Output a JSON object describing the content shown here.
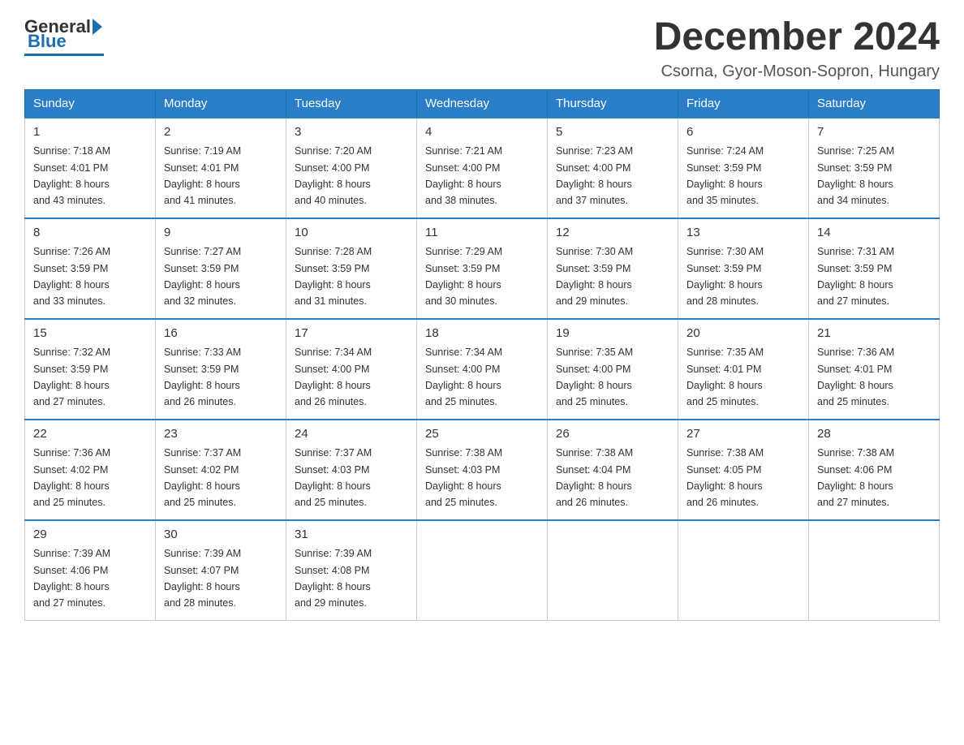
{
  "logo": {
    "general": "General",
    "blue": "Blue"
  },
  "title": "December 2024",
  "subtitle": "Csorna, Gyor-Moson-Sopron, Hungary",
  "days_of_week": [
    "Sunday",
    "Monday",
    "Tuesday",
    "Wednesday",
    "Thursday",
    "Friday",
    "Saturday"
  ],
  "weeks": [
    [
      {
        "day": "1",
        "sunrise": "7:18 AM",
        "sunset": "4:01 PM",
        "daylight": "8 hours and 43 minutes."
      },
      {
        "day": "2",
        "sunrise": "7:19 AM",
        "sunset": "4:01 PM",
        "daylight": "8 hours and 41 minutes."
      },
      {
        "day": "3",
        "sunrise": "7:20 AM",
        "sunset": "4:00 PM",
        "daylight": "8 hours and 40 minutes."
      },
      {
        "day": "4",
        "sunrise": "7:21 AM",
        "sunset": "4:00 PM",
        "daylight": "8 hours and 38 minutes."
      },
      {
        "day": "5",
        "sunrise": "7:23 AM",
        "sunset": "4:00 PM",
        "daylight": "8 hours and 37 minutes."
      },
      {
        "day": "6",
        "sunrise": "7:24 AM",
        "sunset": "3:59 PM",
        "daylight": "8 hours and 35 minutes."
      },
      {
        "day": "7",
        "sunrise": "7:25 AM",
        "sunset": "3:59 PM",
        "daylight": "8 hours and 34 minutes."
      }
    ],
    [
      {
        "day": "8",
        "sunrise": "7:26 AM",
        "sunset": "3:59 PM",
        "daylight": "8 hours and 33 minutes."
      },
      {
        "day": "9",
        "sunrise": "7:27 AM",
        "sunset": "3:59 PM",
        "daylight": "8 hours and 32 minutes."
      },
      {
        "day": "10",
        "sunrise": "7:28 AM",
        "sunset": "3:59 PM",
        "daylight": "8 hours and 31 minutes."
      },
      {
        "day": "11",
        "sunrise": "7:29 AM",
        "sunset": "3:59 PM",
        "daylight": "8 hours and 30 minutes."
      },
      {
        "day": "12",
        "sunrise": "7:30 AM",
        "sunset": "3:59 PM",
        "daylight": "8 hours and 29 minutes."
      },
      {
        "day": "13",
        "sunrise": "7:30 AM",
        "sunset": "3:59 PM",
        "daylight": "8 hours and 28 minutes."
      },
      {
        "day": "14",
        "sunrise": "7:31 AM",
        "sunset": "3:59 PM",
        "daylight": "8 hours and 27 minutes."
      }
    ],
    [
      {
        "day": "15",
        "sunrise": "7:32 AM",
        "sunset": "3:59 PM",
        "daylight": "8 hours and 27 minutes."
      },
      {
        "day": "16",
        "sunrise": "7:33 AM",
        "sunset": "3:59 PM",
        "daylight": "8 hours and 26 minutes."
      },
      {
        "day": "17",
        "sunrise": "7:34 AM",
        "sunset": "4:00 PM",
        "daylight": "8 hours and 26 minutes."
      },
      {
        "day": "18",
        "sunrise": "7:34 AM",
        "sunset": "4:00 PM",
        "daylight": "8 hours and 25 minutes."
      },
      {
        "day": "19",
        "sunrise": "7:35 AM",
        "sunset": "4:00 PM",
        "daylight": "8 hours and 25 minutes."
      },
      {
        "day": "20",
        "sunrise": "7:35 AM",
        "sunset": "4:01 PM",
        "daylight": "8 hours and 25 minutes."
      },
      {
        "day": "21",
        "sunrise": "7:36 AM",
        "sunset": "4:01 PM",
        "daylight": "8 hours and 25 minutes."
      }
    ],
    [
      {
        "day": "22",
        "sunrise": "7:36 AM",
        "sunset": "4:02 PM",
        "daylight": "8 hours and 25 minutes."
      },
      {
        "day": "23",
        "sunrise": "7:37 AM",
        "sunset": "4:02 PM",
        "daylight": "8 hours and 25 minutes."
      },
      {
        "day": "24",
        "sunrise": "7:37 AM",
        "sunset": "4:03 PM",
        "daylight": "8 hours and 25 minutes."
      },
      {
        "day": "25",
        "sunrise": "7:38 AM",
        "sunset": "4:03 PM",
        "daylight": "8 hours and 25 minutes."
      },
      {
        "day": "26",
        "sunrise": "7:38 AM",
        "sunset": "4:04 PM",
        "daylight": "8 hours and 26 minutes."
      },
      {
        "day": "27",
        "sunrise": "7:38 AM",
        "sunset": "4:05 PM",
        "daylight": "8 hours and 26 minutes."
      },
      {
        "day": "28",
        "sunrise": "7:38 AM",
        "sunset": "4:06 PM",
        "daylight": "8 hours and 27 minutes."
      }
    ],
    [
      {
        "day": "29",
        "sunrise": "7:39 AM",
        "sunset": "4:06 PM",
        "daylight": "8 hours and 27 minutes."
      },
      {
        "day": "30",
        "sunrise": "7:39 AM",
        "sunset": "4:07 PM",
        "daylight": "8 hours and 28 minutes."
      },
      {
        "day": "31",
        "sunrise": "7:39 AM",
        "sunset": "4:08 PM",
        "daylight": "8 hours and 29 minutes."
      },
      null,
      null,
      null,
      null
    ]
  ],
  "labels": {
    "sunrise": "Sunrise:",
    "sunset": "Sunset:",
    "daylight": "Daylight:"
  }
}
